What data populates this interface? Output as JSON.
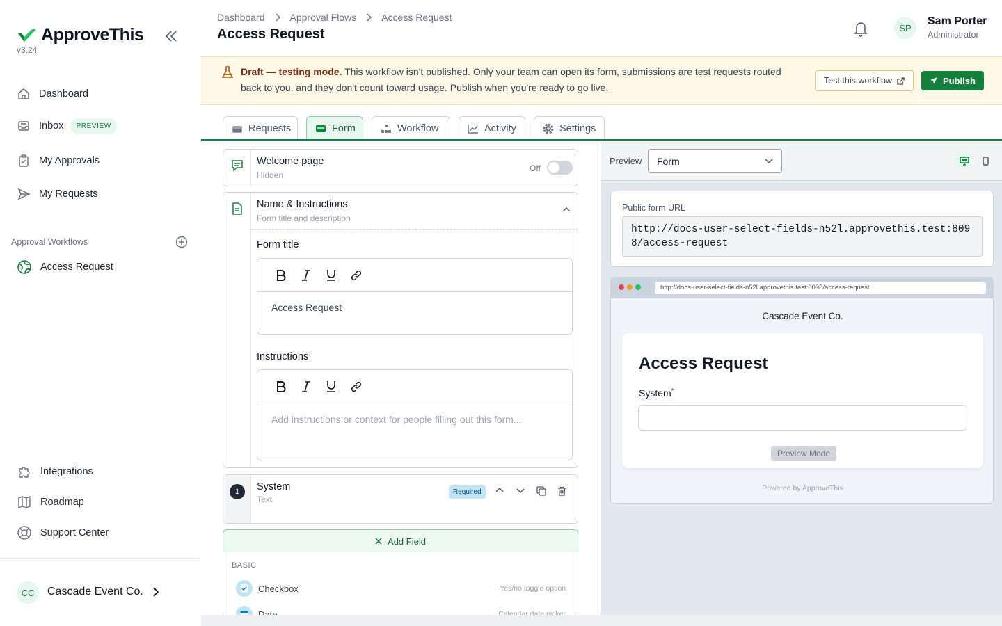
{
  "app": {
    "name": "ApproveThis",
    "version": "v3.24"
  },
  "nav": {
    "dashboard": "Dashboard",
    "inbox": "Inbox",
    "inbox_badge": "PREVIEW",
    "my_approvals": "My Approvals",
    "my_requests": "My Requests",
    "section_label": "Approval Workflows",
    "workflow_item": "Access Request",
    "integrations": "Integrations",
    "roadmap": "Roadmap",
    "support": "Support Center"
  },
  "org": {
    "initials": "CC",
    "name": "Cascade Event Co."
  },
  "header": {
    "breadcrumb": [
      "Dashboard",
      "Approval Flows",
      "Access Request"
    ],
    "title": "Access Request",
    "user": {
      "initials": "SP",
      "name": "Sam Porter",
      "role": "Administrator"
    }
  },
  "banner": {
    "strong": "Draft — testing mode.",
    "text": " This workflow isn't published. Only your team can open its form, submissions are test requests routed back to you, and they don't count toward usage. Publish when you're ready to go live.",
    "test_button": "Test this workflow",
    "publish_button": "Publish"
  },
  "tabs": [
    {
      "label": "Requests",
      "icon": "inbox-icon"
    },
    {
      "label": "Form",
      "icon": "form-icon",
      "active": true
    },
    {
      "label": "Workflow",
      "icon": "workflow-icon"
    },
    {
      "label": "Activity",
      "icon": "chart-line-icon"
    },
    {
      "label": "Settings",
      "icon": "gear-icon"
    }
  ],
  "editor": {
    "welcome": {
      "title": "Welcome page",
      "sub": "Hidden",
      "toggle_label": "Off",
      "enabled": false
    },
    "name_instructions": {
      "title": "Name & Instructions",
      "sub": "Form title and description",
      "form_title_label": "Form title",
      "form_title_value": "Access Request",
      "instructions_label": "Instructions",
      "instructions_placeholder": "Add instructions or context for people filling out this form..."
    },
    "system_field": {
      "number": "1",
      "title": "System",
      "sub": "Text",
      "badge": "Required"
    },
    "add_field": "Add Field",
    "basic_label": "BASIC",
    "field_options": [
      {
        "name": "Checkbox",
        "desc": "Yes/no toggle option"
      },
      {
        "name": "Date",
        "desc": "Calendar date picker"
      }
    ]
  },
  "preview": {
    "label": "Preview",
    "select_value": "Form",
    "url_label": "Public form URL",
    "url": "http://docs-user-select-fields-n52l.approvethis.test:8098/access-request",
    "browser_url": "http://docs-user-select-fields-n52l.approvethis.test:8098/access-request",
    "company": "Cascade Event Co.",
    "form_title": "Access Request",
    "field_label": "System",
    "required_marker": "*",
    "preview_mode": "Preview Mode",
    "powered_by": "Powered by ApproveThis"
  },
  "colors": {
    "brand": "#15803d",
    "banner_bg": "#fef9e7",
    "accent_light": "#e7f6ee"
  }
}
